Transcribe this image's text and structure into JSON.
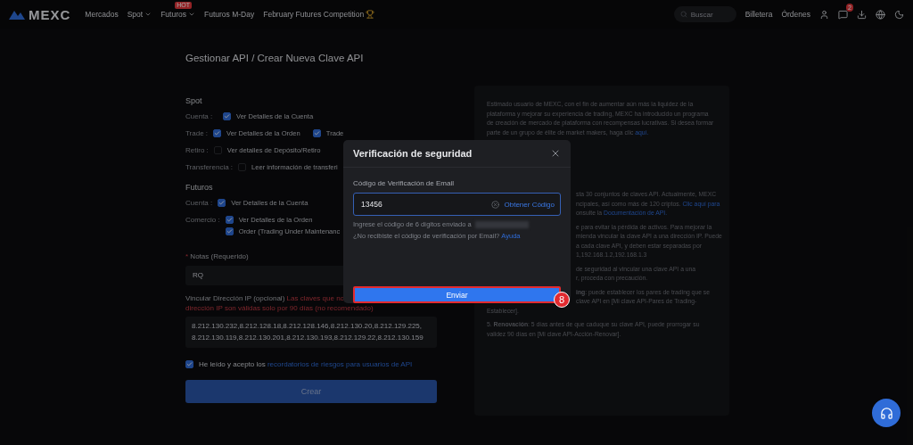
{
  "topbar": {
    "logo": "MEXC",
    "nav": [
      {
        "label": "Mercados",
        "kind": "plain"
      },
      {
        "label": "Spot",
        "kind": "menu"
      },
      {
        "label": "Futuros",
        "kind": "menu",
        "badge": "HOT"
      },
      {
        "label": "Futuros M-Day",
        "kind": "plain"
      },
      {
        "label": "February Futures Competition",
        "kind": "trophy"
      }
    ],
    "search": {
      "placeholder": "Buscar"
    },
    "links": [
      "Billetera",
      "Órdenes"
    ],
    "notification_badge": "2"
  },
  "form": {
    "title": "Gestionar API / Crear Nueva Clave API",
    "sections": [
      {
        "title": "Spot",
        "rows": [
          {
            "label": "Cuenta :",
            "options": [
              {
                "text": "Ver Detalles de la Cuenta",
                "checked": true
              }
            ]
          },
          {
            "label": "Trade :",
            "options": [
              {
                "text": "Ver Detalles de la Orden",
                "checked": true
              },
              {
                "text": "Trade",
                "checked": true
              }
            ]
          },
          {
            "label": "Retiro :",
            "options": [
              {
                "text": "Ver detalles de Depósito/Retiro",
                "checked": false
              }
            ]
          },
          {
            "label": "Transferencia :",
            "options": [
              {
                "text": "Leer información de transferi",
                "checked": false
              }
            ]
          }
        ]
      },
      {
        "title": "Futuros",
        "rows": [
          {
            "label": "Cuenta :",
            "options": [
              {
                "text": "Ver Detalles de la Cuenta",
                "checked": true
              }
            ]
          },
          {
            "label": "Comercio :",
            "stacked": true,
            "options": [
              {
                "text": "Ver Detalles de la Orden",
                "checked": true
              },
              {
                "text": "Order (Trading Under Maintenanc",
                "checked": true
              }
            ]
          }
        ]
      }
    ],
    "notes": {
      "label": "Notas (Requerido)",
      "required_mark": "*",
      "value": "RQ"
    },
    "ip": {
      "label": "Vincular Dirección IP (opcional)",
      "warning": "Las claves que no",
      "warning_2": "dirección IP son válidas solo por 90 días (no recomendado)",
      "value": "8.212.130.232,8.212.128.18,8.212.128.146,8.212.130.20,8.212.129.225, 8.212.130.119,8.212.130.201,8.212.130.193,8.212.129.22,8.212.130.159"
    },
    "agreement": {
      "text": "He leído y acepto los",
      "link": "recordatorios de riesgos para usuarios de API",
      "checked": true
    },
    "submit": "Crear"
  },
  "info": {
    "intro": [
      {
        "text": "Estimado usuario de MEXC, con el fin de aumentar aún más la liquidez de la"
      },
      {
        "text": "plataforma y mejorar su experiencia de trading, MEXC ha introducido un programa"
      },
      {
        "text": "de creación de mercado de plataforma con recompensas lucrativas. Si desea formar"
      },
      {
        "text": "parte de un grupo de élite de market makers, haga clic",
        "link": "aquí."
      }
    ],
    "lines": [
      {
        "kind": "partial",
        "text": "sta 30 conjuntos de claves API. Actualmente, MEXC"
      },
      {
        "kind": "partial",
        "text": "ncipales, así como más de 120 criptos.",
        "link": "Clic aquí para"
      },
      {
        "kind": "partial",
        "text": "onsulte la",
        "link": "Documentación de API."
      },
      {
        "kind": "gap",
        "text": "e para evitar la pérdida de activos. Para mejorar la"
      },
      {
        "kind": "partial",
        "text": "mienda vincular la clave API a una dirección IP. Puede"
      },
      {
        "kind": "partial",
        "text": "a cada clave API, y deben estar separadas por"
      },
      {
        "kind": "partial",
        "text": "1,192.168.1.2,192.168.1.3"
      },
      {
        "kind": "gap",
        "text": "de seguridad al vincular una clave API a una"
      },
      {
        "kind": "partial",
        "text": "r, proceda con precaución."
      },
      {
        "kind": "gap",
        "text": "**ing**: puede establecer los pares de trading que se"
      },
      {
        "kind": "partial",
        "text": "clave API en [Mi clave API-Pares de Trading-"
      },
      {
        "kind": "full",
        "text": "Establecer]."
      },
      {
        "kind": "gapfull",
        "text": "5. **Renovación**: 5 días antes de que caduque su clave API, puede prorrogar su"
      },
      {
        "kind": "full",
        "text": "validez 90 días en [Mi clave API-Acción-Renovar]."
      }
    ]
  },
  "modal": {
    "title": "Verificación de seguridad",
    "field_label": "Código de Verificación de Email",
    "value": "13456",
    "get_code": "Obtener Código",
    "hint": "Ingrese el código de 6 dígitos enviado a",
    "help": "¿No recibiste el código de verificación por Email?",
    "help_link": "Ayuda",
    "submit": {
      "label": "Enviar",
      "highlighted": true
    },
    "step_badge": "8"
  }
}
